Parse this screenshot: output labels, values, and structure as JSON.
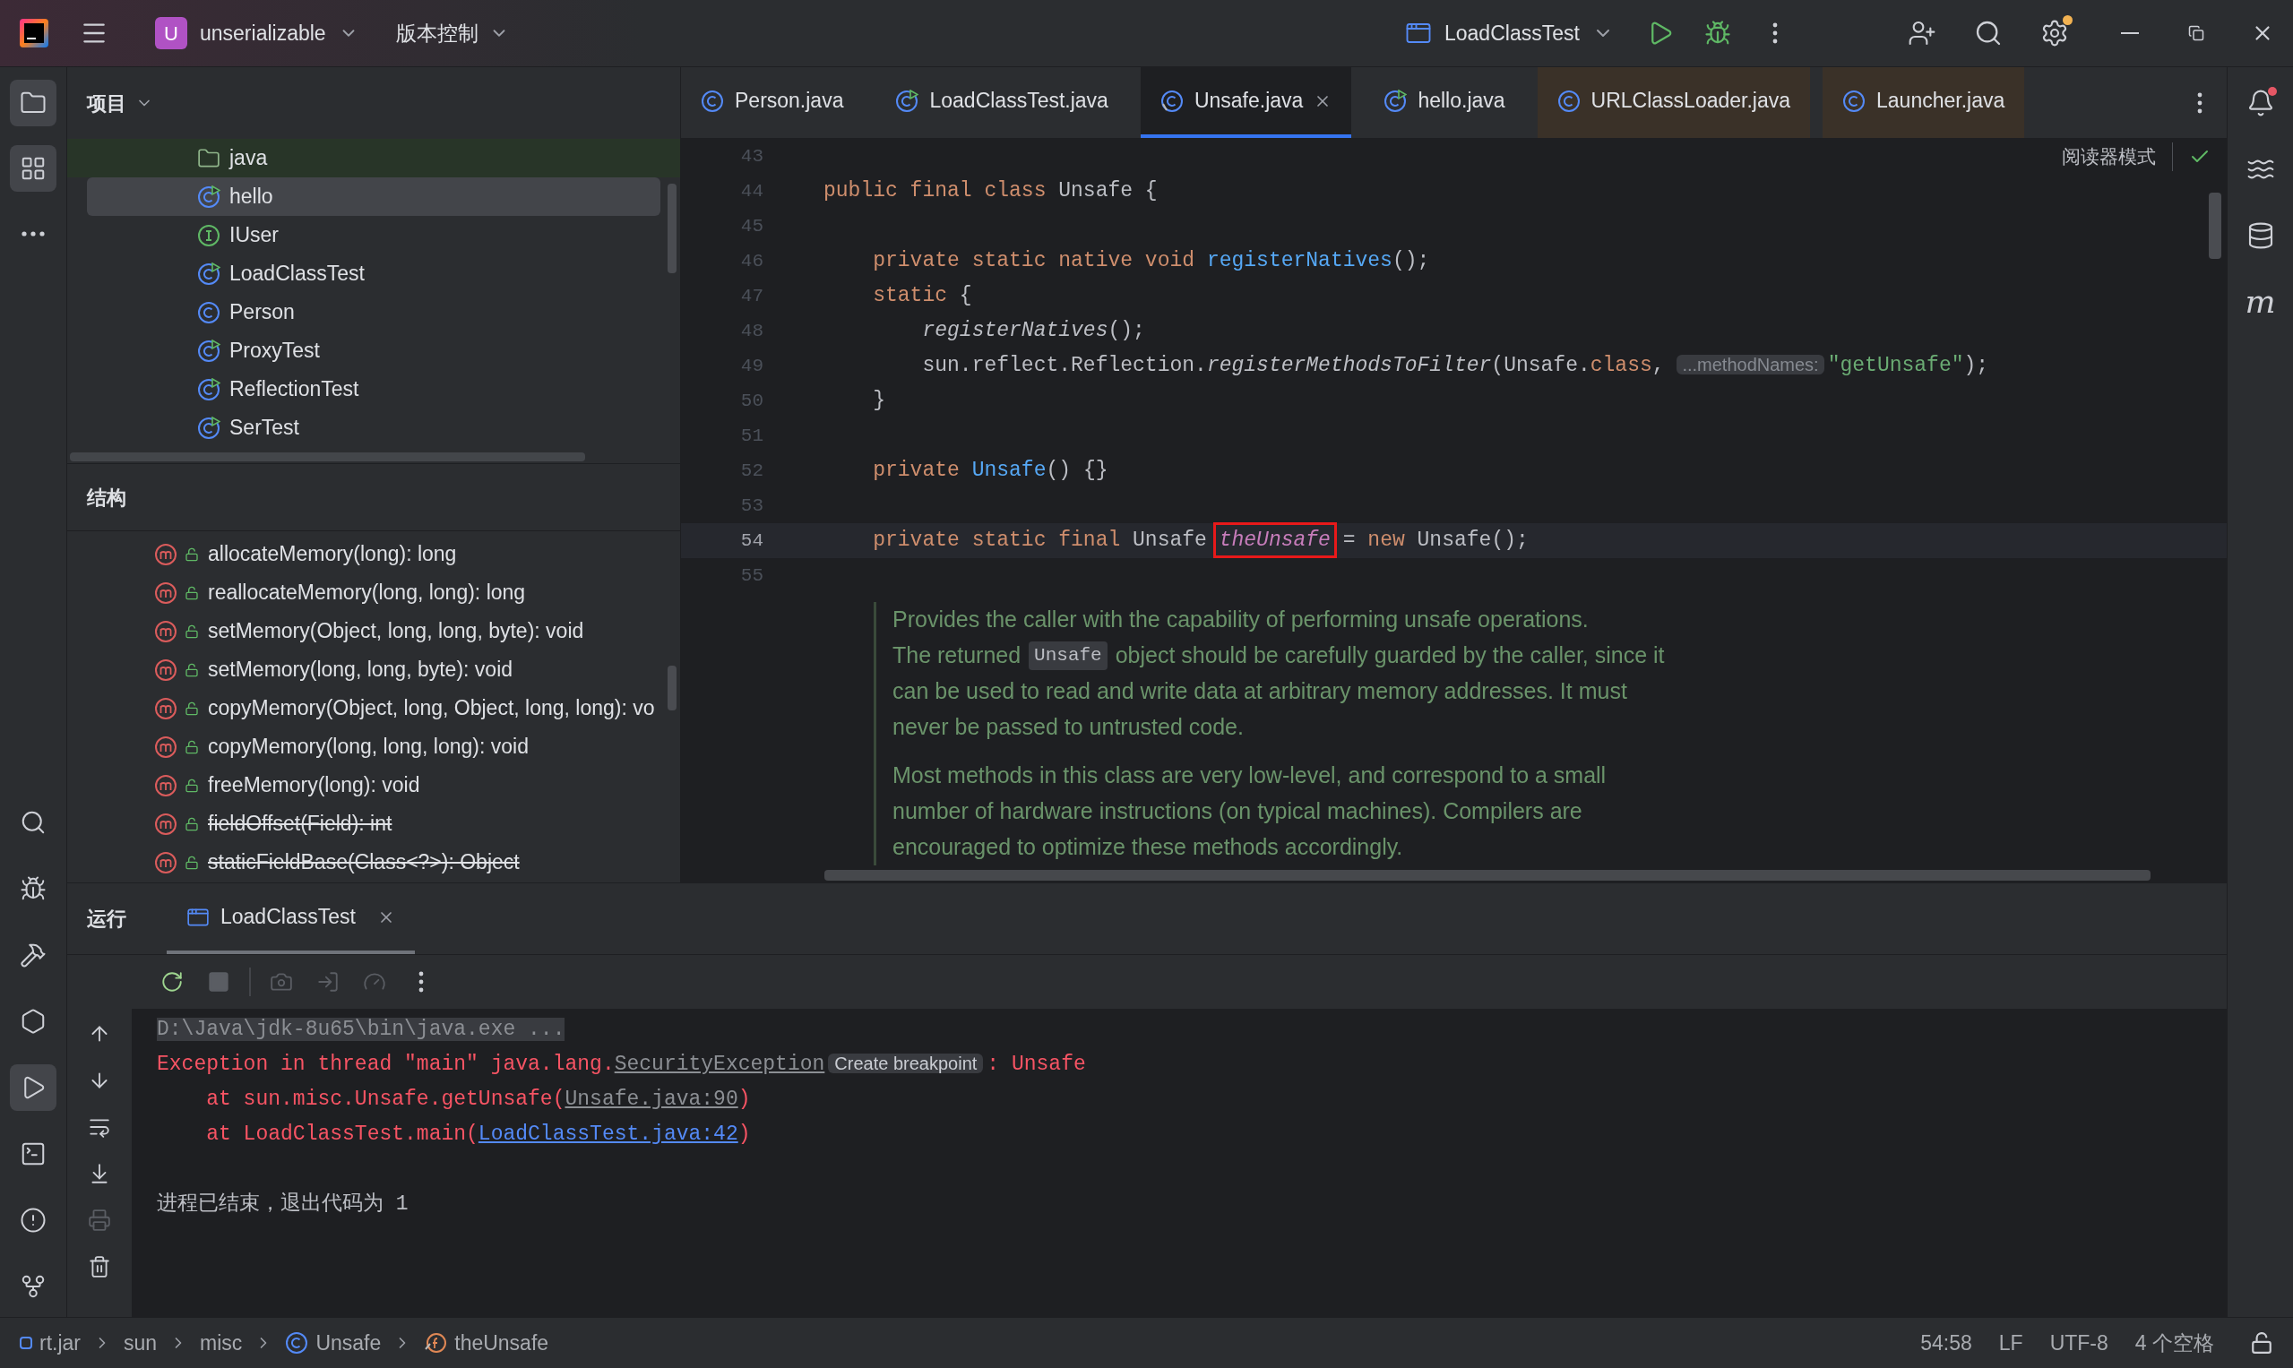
{
  "title_bar": {
    "project_badge": "U",
    "project": "unserializable",
    "vcs": "版本控制",
    "run_config": "LoadClassTest"
  },
  "left_toolbar": {
    "top": [
      {
        "kind": "project",
        "selected": true
      },
      {
        "kind": "structure",
        "selected": true
      },
      {
        "kind": "more",
        "selected": false
      }
    ],
    "bottom": [
      {
        "kind": "search",
        "selected": false
      },
      {
        "kind": "debug",
        "selected": false
      },
      {
        "kind": "build",
        "selected": false
      },
      {
        "kind": "services",
        "selected": false
      },
      {
        "kind": "run",
        "selected": true
      },
      {
        "kind": "terminal",
        "selected": false
      },
      {
        "kind": "problems",
        "selected": false
      },
      {
        "kind": "git",
        "selected": false
      }
    ]
  },
  "right_toolbar": [
    {
      "kind": "notifications",
      "badge": true
    },
    {
      "kind": "ai",
      "badge": false
    },
    {
      "kind": "database",
      "badge": false
    },
    {
      "kind": "maven",
      "badge": false,
      "glyph": "m"
    }
  ],
  "project_panel": {
    "title": "项目",
    "items": [
      {
        "kind": "source-folder",
        "label": "java",
        "selected": false
      },
      {
        "kind": "runnable",
        "label": "hello",
        "selected": true
      },
      {
        "kind": "interface",
        "label": "IUser",
        "selected": false
      },
      {
        "kind": "runnable",
        "label": "LoadClassTest",
        "selected": false
      },
      {
        "kind": "class",
        "label": "Person",
        "selected": false
      },
      {
        "kind": "runnable",
        "label": "ProxyTest",
        "selected": false
      },
      {
        "kind": "runnable",
        "label": "ReflectionTest",
        "selected": false
      },
      {
        "kind": "runnable",
        "label": "SerTest",
        "selected": false
      }
    ]
  },
  "structure_panel": {
    "title": "结构",
    "items": [
      {
        "name": "allocateMemory(long): long",
        "deprecated": false
      },
      {
        "name": "reallocateMemory(long, long): long",
        "deprecated": false
      },
      {
        "name": "setMemory(Object, long, long, byte): void",
        "deprecated": false
      },
      {
        "name": "setMemory(long, long, byte): void",
        "deprecated": false
      },
      {
        "name": "copyMemory(Object, long, Object, long, long): vo",
        "deprecated": false
      },
      {
        "name": "copyMemory(long, long, long): void",
        "deprecated": false
      },
      {
        "name": "freeMemory(long): void",
        "deprecated": false
      },
      {
        "name": "fieldOffset(Field): int",
        "deprecated": true
      },
      {
        "name": "staticFieldBase(Class<?>): Object",
        "deprecated": true
      }
    ]
  },
  "editor": {
    "tabs": [
      {
        "kind": "class",
        "label": "Person.java",
        "selected": false,
        "tinted": false
      },
      {
        "kind": "runnable",
        "label": "LoadClassTest.java",
        "selected": false,
        "tinted": false
      },
      {
        "kind": "library",
        "label": "Unsafe.java",
        "selected": true,
        "tinted": false
      },
      {
        "kind": "runnable",
        "label": "hello.java",
        "selected": false,
        "tinted": false
      },
      {
        "kind": "class",
        "label": "URLClassLoader.java",
        "selected": false,
        "tinted": true
      },
      {
        "kind": "class",
        "label": "Launcher.java",
        "selected": false,
        "tinted": true
      }
    ],
    "reader_mode": "阅读器模式",
    "lines": [
      {
        "number": "43",
        "current": false
      },
      {
        "number": "44",
        "current": false,
        "tokens": [
          {
            "kind": "keyword",
            "text": "public final class "
          },
          {
            "kind": "plain",
            "text": "Unsafe {"
          }
        ]
      },
      {
        "number": "45",
        "current": false
      },
      {
        "number": "46",
        "current": false,
        "tokens": [
          {
            "kind": "keyword",
            "text": "    private static native void "
          },
          {
            "kind": "declaration",
            "text": "registerNatives"
          },
          {
            "kind": "plain",
            "text": "();"
          }
        ]
      },
      {
        "number": "47",
        "current": false,
        "tokens": [
          {
            "kind": "keyword",
            "text": "    static "
          },
          {
            "kind": "plain",
            "text": "{"
          }
        ]
      },
      {
        "number": "48",
        "current": false,
        "tokens": [
          {
            "kind": "italic",
            "text": "        registerNatives"
          },
          {
            "kind": "plain",
            "text": "();"
          }
        ]
      },
      {
        "number": "49",
        "current": false,
        "tokens": [
          {
            "kind": "plain",
            "text": "        sun.reflect.Reflection."
          },
          {
            "kind": "italic",
            "text": "registerMethodsToFilter"
          },
          {
            "kind": "plain",
            "text": "(Unsafe."
          },
          {
            "kind": "keyword",
            "text": "class"
          },
          {
            "kind": "plain",
            "text": ", "
          },
          {
            "kind": "hint",
            "text": "...methodNames:"
          },
          {
            "kind": "string",
            "text": "\"getUnsafe\""
          },
          {
            "kind": "plain",
            "text": ");"
          }
        ]
      },
      {
        "number": "50",
        "current": false,
        "tokens": [
          {
            "kind": "plain",
            "text": "    }"
          }
        ]
      },
      {
        "number": "51",
        "current": false
      },
      {
        "number": "52",
        "current": false,
        "tokens": [
          {
            "kind": "keyword",
            "text": "    private "
          },
          {
            "kind": "declaration",
            "text": "Unsafe"
          },
          {
            "kind": "plain",
            "text": "() {}"
          }
        ]
      },
      {
        "number": "53",
        "current": false
      },
      {
        "number": "54",
        "current": true,
        "tokens": [
          {
            "kind": "keyword",
            "text": "    private static final "
          },
          {
            "kind": "plain",
            "text": "Unsafe "
          },
          {
            "kind": "boxed-field",
            "text": "theUnsafe"
          },
          {
            "kind": "plain",
            "text": " = "
          },
          {
            "kind": "keyword",
            "text": "new "
          },
          {
            "kind": "plain",
            "text": "Unsafe();"
          }
        ]
      },
      {
        "number": "55",
        "current": false
      }
    ],
    "doc": [
      [
        [
          {
            "kind": "text",
            "text": "Provides the caller with the capability of performing unsafe operations."
          }
        ],
        [
          {
            "kind": "text",
            "text": "The returned "
          },
          {
            "kind": "code",
            "text": "Unsafe"
          },
          {
            "kind": "text",
            "text": " object should be carefully guarded by the caller, since it"
          }
        ],
        [
          {
            "kind": "text",
            "text": "can be used to read and write data at arbitrary memory addresses. It must"
          }
        ],
        [
          {
            "kind": "text",
            "text": "never be passed to untrusted code."
          }
        ]
      ],
      [
        [
          {
            "kind": "text",
            "text": "Most methods in this class are very low-level, and correspond to a small"
          }
        ],
        [
          {
            "kind": "text",
            "text": "number of hardware instructions (on typical machines). Compilers are"
          }
        ],
        [
          {
            "kind": "text",
            "text": "encouraged to optimize these methods accordingly."
          }
        ]
      ]
    ]
  },
  "run_panel": {
    "title": "运行",
    "tabs": [
      {
        "label": "LoadClassTest",
        "selected": true
      }
    ],
    "toolbar": [
      {
        "kind": "rerun",
        "disabled": false
      },
      {
        "kind": "stop",
        "disabled": true
      },
      {
        "kind": "dump",
        "disabled": true
      },
      {
        "kind": "exit",
        "disabled": true
      },
      {
        "kind": "profile",
        "disabled": true
      },
      {
        "kind": "more",
        "disabled": false
      }
    ],
    "side_tools": [
      {
        "kind": "up",
        "disabled": false
      },
      {
        "kind": "down",
        "disabled": false
      },
      {
        "kind": "wrap",
        "disabled": false
      },
      {
        "kind": "scroll-end",
        "disabled": false
      },
      {
        "kind": "print",
        "disabled": true
      },
      {
        "kind": "clear",
        "disabled": false
      }
    ],
    "console": [
      [
        {
          "kind": "command",
          "text": "D:\\Java\\jdk-8u65\\bin\\java.exe ..."
        }
      ],
      [
        {
          "kind": "error",
          "text": "Exception in thread \"main\" java.lang."
        },
        {
          "kind": "error-link",
          "text": "SecurityException"
        },
        {
          "kind": "hint",
          "text": "Create breakpoint"
        },
        {
          "kind": "error",
          "text": ": Unsafe"
        }
      ],
      [
        {
          "kind": "error",
          "text": "    at sun.misc.Unsafe.getUnsafe("
        },
        {
          "kind": "muted-link",
          "text": "Unsafe.java:90"
        },
        {
          "kind": "error",
          "text": ")"
        }
      ],
      [
        {
          "kind": "error",
          "text": "    at LoadClassTest.main("
        },
        {
          "kind": "link",
          "text": "LoadClassTest.java:42"
        },
        {
          "kind": "error",
          "text": ")"
        }
      ],
      [
        {
          "kind": "spacer"
        }
      ],
      [
        {
          "kind": "plain",
          "text": "进程已结束，退出代码为 1"
        }
      ]
    ]
  },
  "status_bar": {
    "breadcrumbs": [
      {
        "kind": "module",
        "label": "rt.jar"
      },
      {
        "kind": "package",
        "label": "sun"
      },
      {
        "kind": "package",
        "label": "misc"
      },
      {
        "kind": "class",
        "label": "Unsafe"
      },
      {
        "kind": "field",
        "label": "theUnsafe"
      }
    ],
    "items": [
      "54:58",
      "LF",
      "UTF-8",
      "4 个空格"
    ]
  }
}
